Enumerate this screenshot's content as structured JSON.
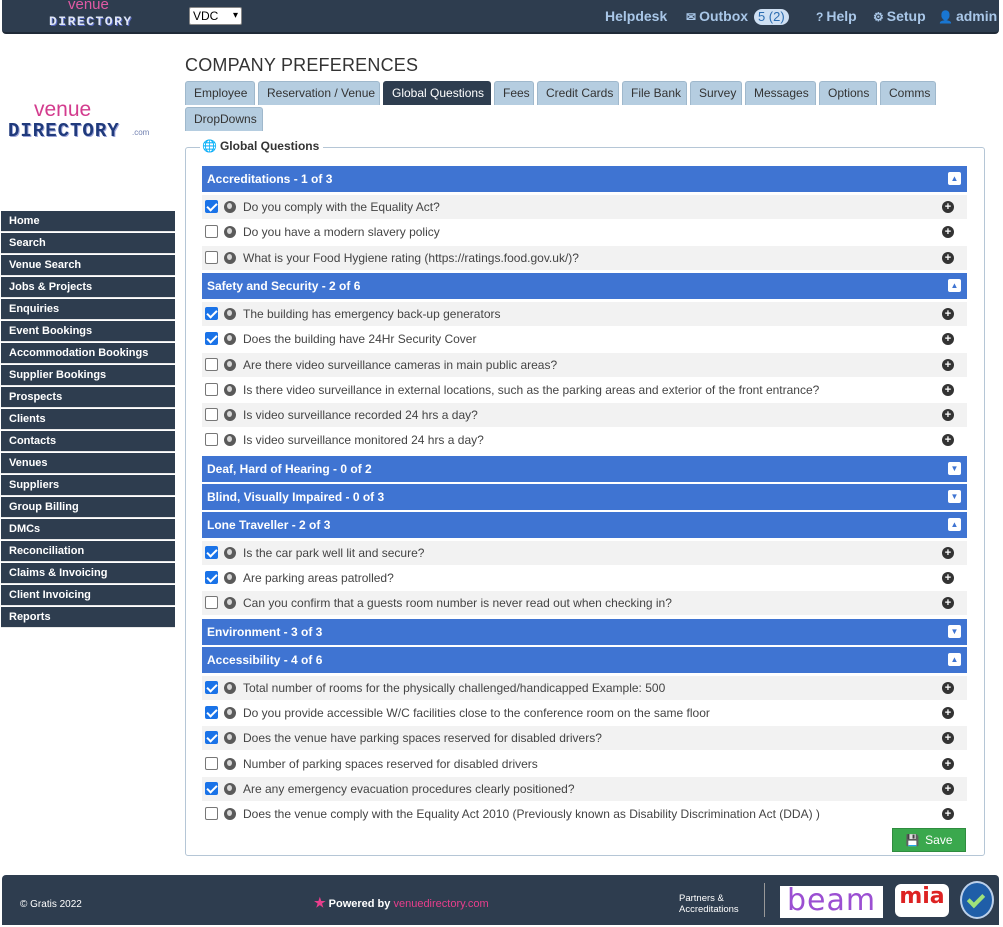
{
  "topbar": {
    "logo_top": "venue",
    "logo_bottom": "DIRECTORY",
    "company_select": "VDC",
    "helpdesk": "Helpdesk",
    "outbox": "Outbox",
    "outbox_badge": "5 (2)",
    "help": "Help",
    "setup": "Setup",
    "user": "admin"
  },
  "side_logo": {
    "line1": "venue",
    "line2": "DIRECTORY",
    "line3": ".com"
  },
  "nav": [
    "Home",
    "Search",
    "Venue Search",
    "Jobs & Projects",
    "Enquiries",
    "Event Bookings",
    "Accommodation Bookings",
    "Supplier Bookings",
    "Prospects",
    "Clients",
    "Contacts",
    "Venues",
    "Suppliers",
    "Group Billing",
    "DMCs",
    "Reconciliation",
    "Claims & Invoicing",
    "Client Invoicing",
    "Reports"
  ],
  "page": {
    "title": "COMPANY PREFERENCES",
    "tabs": [
      {
        "label": "Employee",
        "active": false
      },
      {
        "label": "Reservation / Venue",
        "active": false
      },
      {
        "label": "Global Questions",
        "active": true
      },
      {
        "label": "Fees",
        "active": false
      },
      {
        "label": "Credit Cards",
        "active": false
      },
      {
        "label": "File Bank",
        "active": false
      },
      {
        "label": "Survey",
        "active": false
      },
      {
        "label": "Messages",
        "active": false
      },
      {
        "label": "Options",
        "active": false
      },
      {
        "label": "Comms",
        "active": false
      },
      {
        "label": "DropDowns",
        "active": false
      }
    ],
    "panel_legend": "Global Questions",
    "groups": [
      {
        "title": "Accreditations - 1 of 3",
        "expanded": true,
        "questions": [
          {
            "text": "Do you comply with the Equality Act?",
            "checked": true
          },
          {
            "text": "Do you have a modern slavery policy",
            "checked": false
          },
          {
            "text": "What is your Food Hygiene rating (https://ratings.food.gov.uk/)?",
            "checked": false
          }
        ]
      },
      {
        "title": "Safety and Security - 2 of 6",
        "expanded": true,
        "questions": [
          {
            "text": "The building has emergency back-up generators",
            "checked": true
          },
          {
            "text": "Does the building have 24Hr Security Cover",
            "checked": true
          },
          {
            "text": "Are there video surveillance cameras in main public areas?",
            "checked": false
          },
          {
            "text": "Is there video surveillance in external locations, such as the parking areas and exterior of the front entrance?",
            "checked": false
          },
          {
            "text": "Is video surveillance recorded 24 hrs a day?",
            "checked": false
          },
          {
            "text": "Is video surveillance monitored 24 hrs a day?",
            "checked": false
          }
        ]
      },
      {
        "title": "Deaf, Hard of Hearing - 0 of 2",
        "expanded": false,
        "questions": []
      },
      {
        "title": "Blind, Visually Impaired - 0 of 3",
        "expanded": false,
        "questions": []
      },
      {
        "title": "Lone Traveller - 2 of 3",
        "expanded": true,
        "questions": [
          {
            "text": "Is the car park well lit and secure?",
            "checked": true
          },
          {
            "text": "Are parking areas patrolled?",
            "checked": true
          },
          {
            "text": "Can you confirm that a guests room number is never read out when checking in?",
            "checked": false
          }
        ]
      },
      {
        "title": "Environment - 3 of 3",
        "expanded": false,
        "questions": []
      },
      {
        "title": "Accessibility - 4 of 6",
        "expanded": true,
        "questions": [
          {
            "text": "Total number of rooms for the physically challenged/handicapped Example: 500",
            "checked": true
          },
          {
            "text": "Do you provide accessible W/C facilities close to the conference room on the same floor",
            "checked": true
          },
          {
            "text": "Does the venue have parking spaces reserved for disabled drivers?",
            "checked": true
          },
          {
            "text": "Number of parking spaces reserved for disabled drivers",
            "checked": false
          },
          {
            "text": "Are any emergency evacuation procedures clearly positioned?",
            "checked": true
          },
          {
            "text": "Does the venue comply with the Equality Act 2010 (Previously known as Disability Discrimination Act (DDA) )",
            "checked": false
          }
        ]
      }
    ],
    "save_label": "Save"
  },
  "footer": {
    "copyright": "© Gratis 2022",
    "powered_by": "Powered by",
    "powered_brand": "venuedirectory.com",
    "partners_line1": "Partners &",
    "partners_line2": "Accreditations",
    "beam": "beam",
    "mia": "mia"
  }
}
